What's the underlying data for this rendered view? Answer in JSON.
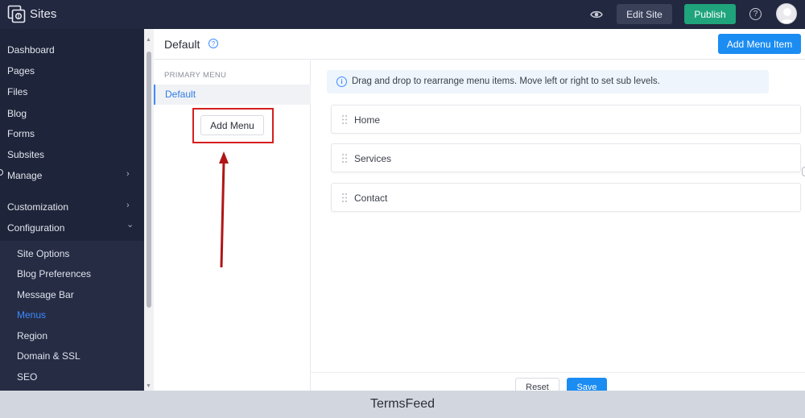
{
  "topbar": {
    "app_title": "Sites",
    "logo_icon": "sites-logo-icon",
    "preview_icon": "eye-icon",
    "edit_site_label": "Edit Site",
    "publish_label": "Publish",
    "help_icon": "help-icon",
    "help_glyph": "?",
    "colors": {
      "bar": "#22283f",
      "publish": "#1fa47c"
    }
  },
  "sidebar": {
    "items": [
      {
        "label": "Dashboard"
      },
      {
        "label": "Pages"
      },
      {
        "label": "Files"
      },
      {
        "label": "Blog"
      },
      {
        "label": "Forms"
      },
      {
        "label": "Subsites"
      },
      {
        "label": "Manage",
        "chevron": "›"
      },
      {
        "label": "Customization",
        "chevron": "›"
      },
      {
        "label": "Configuration",
        "chevron": "⌄"
      }
    ],
    "sub_items": [
      {
        "label": "Site Options"
      },
      {
        "label": "Blog Preferences"
      },
      {
        "label": "Message Bar"
      },
      {
        "label": "Menus",
        "active": true
      },
      {
        "label": "Region"
      },
      {
        "label": "Domain & SSL"
      },
      {
        "label": "SEO"
      }
    ],
    "scroll_up": "▲",
    "scroll_down": "▼"
  },
  "header": {
    "title": "Default",
    "help_glyph": "?",
    "add_menu_item_label": "Add Menu Item"
  },
  "menus_panel": {
    "section_label": "PRIMARY MENU",
    "selected_menu": "Default",
    "add_menu_label": "Add Menu"
  },
  "main": {
    "info_glyph": "i",
    "info_text": "Drag and drop to rearrange menu items. Move left or right to set sub levels.",
    "menu_items": [
      {
        "label": "Home"
      },
      {
        "label": "Services"
      },
      {
        "label": "Contact"
      }
    ]
  },
  "footer": {
    "reset_label": "Reset",
    "save_label": "Save"
  },
  "watermark": {
    "text": "TermsFeed"
  },
  "colors": {
    "accent": "#1b8cf2",
    "highlight": "#d61f1f",
    "annotation_arrow": "#b01616"
  }
}
